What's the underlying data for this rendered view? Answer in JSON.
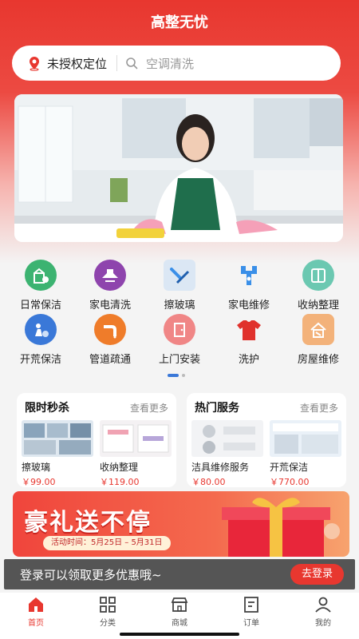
{
  "app": {
    "title": "高整无忧"
  },
  "search": {
    "location": "未授权定位",
    "placeholder": "空调清洗"
  },
  "services": [
    {
      "label": "日常保洁",
      "icon": "house-clean-icon",
      "color": "#3cb371"
    },
    {
      "label": "家电清洗",
      "icon": "range-hood-icon",
      "color": "#8e44ad"
    },
    {
      "label": "擦玻璃",
      "icon": "squeegee-icon",
      "color": "#dbe7f4"
    },
    {
      "label": "家电维修",
      "icon": "wrench-icon",
      "color": "#3a8fe8"
    },
    {
      "label": "收纳整理",
      "icon": "cabinet-icon",
      "color": "#6bc8b1"
    },
    {
      "label": "开荒保洁",
      "icon": "vacuum-cleaner-icon",
      "color": "#3a78d8"
    },
    {
      "label": "管道疏通",
      "icon": "pipe-icon",
      "color": "#ef7c2a"
    },
    {
      "label": "上门安装",
      "icon": "door-icon",
      "color": "#f08686"
    },
    {
      "label": "洗护",
      "icon": "shirt-icon",
      "color": "#e0312c"
    },
    {
      "label": "房屋维修",
      "icon": "house-repair-icon",
      "color": "#f3b27a"
    }
  ],
  "flash_sale": {
    "title": "限时秒杀",
    "more": "查看更多",
    "items": [
      {
        "name": "擦玻璃",
        "price": "￥99.00"
      },
      {
        "name": "收纳整理",
        "price": "￥119.00"
      }
    ]
  },
  "hot_services": {
    "title": "热门服务",
    "more": "查看更多",
    "items": [
      {
        "name": "洁具维修服务",
        "price": "￥80.00"
      },
      {
        "name": "开荒保洁",
        "price": "￥770.00"
      }
    ]
  },
  "promo": {
    "title": "豪礼送不停",
    "date": "活动时间：5月25日 – 5月31日"
  },
  "login_prompt": {
    "text": "登录可以领取更多优惠哦~",
    "button": "去登录"
  },
  "tabs": [
    {
      "label": "首页",
      "icon": "home-icon",
      "active": true
    },
    {
      "label": "分类",
      "icon": "grid-icon",
      "active": false
    },
    {
      "label": "商城",
      "icon": "store-icon",
      "active": false
    },
    {
      "label": "订单",
      "icon": "order-icon",
      "active": false
    },
    {
      "label": "我的",
      "icon": "user-icon",
      "active": false
    }
  ],
  "colors": {
    "brand": "#e8372f",
    "price": "#e8372f"
  }
}
